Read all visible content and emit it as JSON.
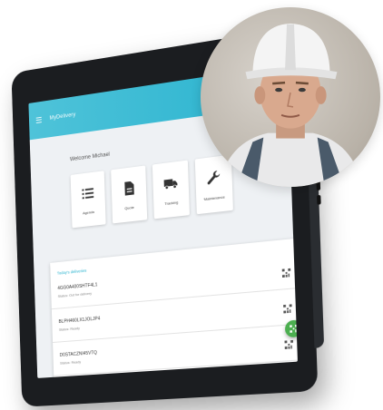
{
  "app": {
    "title": "MyDelivery"
  },
  "welcome": "Welcome Michael",
  "tiles": [
    {
      "label": "Agenda",
      "icon": "list-icon"
    },
    {
      "label": "Quote",
      "icon": "document-icon"
    },
    {
      "label": "Tracking",
      "icon": "truck-icon"
    },
    {
      "label": "Maintenance",
      "icon": "wrench-icon"
    }
  ],
  "deliveries": {
    "heading": "Today's deliveries",
    "rows": [
      {
        "id": "4GG0A400SHTF4L1",
        "status": "Status: Out for delivery"
      },
      {
        "id": "BLPH460LX1JOLJP4",
        "status": "Status: Ready"
      },
      {
        "id": "D0STACZNI45VTQ",
        "status": "Status: Ready"
      }
    ]
  },
  "colors": {
    "accent": "#29b3cf",
    "fab": "#4caf50",
    "device": "#1b1d20"
  },
  "avatar": {
    "icon": "worker-avatar"
  }
}
